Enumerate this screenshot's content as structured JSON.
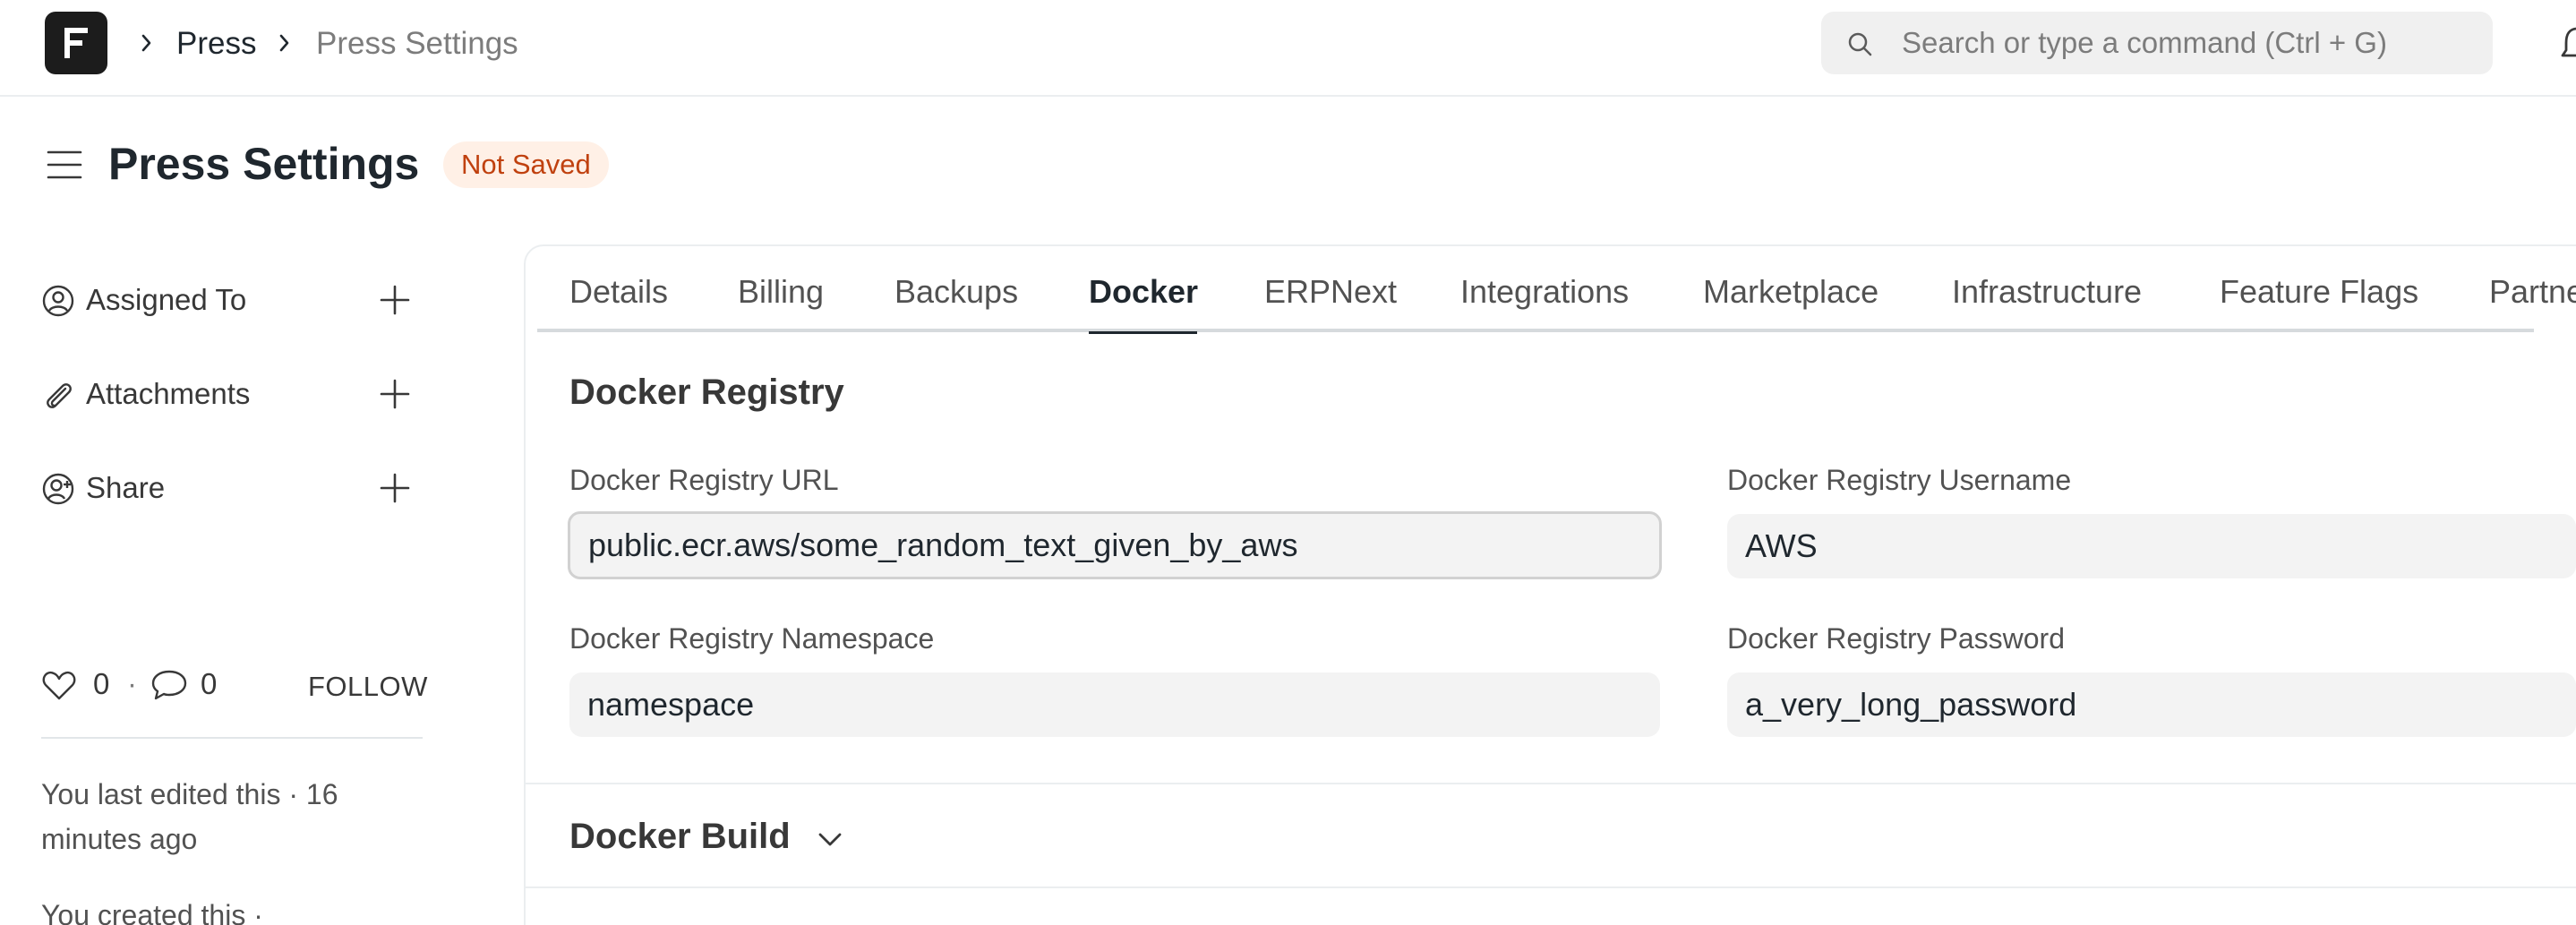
{
  "navbar": {
    "breadcrumbs": [
      "Press",
      "Press Settings"
    ],
    "search_placeholder": "Search or type a command (Ctrl + G)"
  },
  "header": {
    "title": "Press Settings",
    "status": "Not Saved"
  },
  "sidebar": {
    "items": [
      {
        "label": "Assigned To",
        "icon": "user-circle-icon"
      },
      {
        "label": "Attachments",
        "icon": "paperclip-icon"
      },
      {
        "label": "Share",
        "icon": "share-user-icon"
      }
    ],
    "likes_count": "0",
    "separator": "·",
    "comments_count": "0",
    "follow_label": "FOLLOW",
    "activity": [
      "You last edited this · 16 minutes ago",
      "You created this ·"
    ]
  },
  "tabs": [
    {
      "label": "Details",
      "active": false
    },
    {
      "label": "Billing",
      "active": false
    },
    {
      "label": "Backups",
      "active": false
    },
    {
      "label": "Docker",
      "active": true
    },
    {
      "label": "ERPNext",
      "active": false
    },
    {
      "label": "Integrations",
      "active": false
    },
    {
      "label": "Marketplace",
      "active": false
    },
    {
      "label": "Infrastructure",
      "active": false
    },
    {
      "label": "Feature Flags",
      "active": false
    },
    {
      "label": "Partne",
      "active": false
    }
  ],
  "sections": {
    "docker_registry": {
      "title": "Docker Registry",
      "fields": {
        "registry_url": {
          "label": "Docker Registry URL",
          "value": "public.ecr.aws/some_random_text_given_by_aws"
        },
        "registry_username": {
          "label": "Docker Registry Username",
          "value": "AWS"
        },
        "registry_namespace": {
          "label": "Docker Registry Namespace",
          "value": "namespace"
        },
        "registry_password": {
          "label": "Docker Registry Password",
          "value": "a_very_long_password"
        }
      }
    },
    "docker_build": {
      "title": "Docker Build"
    }
  },
  "colors": {
    "status_badge_bg": "#fff0e6",
    "status_badge_text": "#c0410f",
    "logo_bg": "#1c1c1c"
  }
}
